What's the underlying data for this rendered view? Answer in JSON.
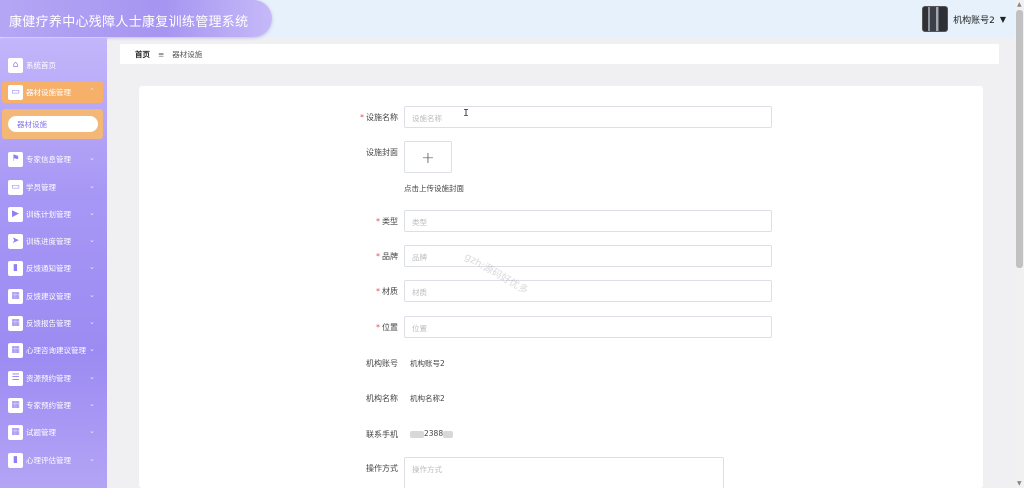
{
  "app": {
    "title": "康健疗养中心残障人士康复训练管理系统"
  },
  "user": {
    "name": "机构账号2",
    "caret": "▼"
  },
  "sidebar": {
    "items": [
      {
        "label": "系统首页",
        "icon": "home-icon",
        "glyph": "⌂"
      },
      {
        "label": "器材设施管理",
        "icon": "monitor-icon",
        "glyph": "▭",
        "chevron": "⌃"
      },
      {
        "label": "专家信息管理",
        "icon": "flag-icon",
        "glyph": "⚑",
        "chevron": "⌄"
      },
      {
        "label": "学员管理",
        "icon": "monitor-icon",
        "glyph": "▭",
        "chevron": "⌄"
      },
      {
        "label": "训练计划管理",
        "icon": "video-icon",
        "glyph": "▶",
        "chevron": "⌄"
      },
      {
        "label": "训练进度管理",
        "icon": "send-icon",
        "glyph": "➤",
        "chevron": "⌄"
      },
      {
        "label": "反馈通知管理",
        "icon": "bar-chart-icon",
        "glyph": "▮",
        "chevron": "⌄"
      },
      {
        "label": "反馈建议管理",
        "icon": "grid-icon",
        "glyph": "▦",
        "chevron": "⌄"
      },
      {
        "label": "反馈报告管理",
        "icon": "grid-icon",
        "glyph": "▦",
        "chevron": "⌄"
      },
      {
        "label": "心理咨询建议管理",
        "icon": "grid-icon",
        "glyph": "▦",
        "chevron": "⌄"
      },
      {
        "label": "资源预约管理",
        "icon": "sliders-icon",
        "glyph": "☰",
        "chevron": "⌄"
      },
      {
        "label": "专家预约管理",
        "icon": "apps-icon",
        "glyph": "▦",
        "chevron": "⌄"
      },
      {
        "label": "试题管理",
        "icon": "grid-icon",
        "glyph": "▦",
        "chevron": "⌄"
      },
      {
        "label": "心理评估管理",
        "icon": "book-icon",
        "glyph": "▮",
        "chevron": "⌄"
      }
    ],
    "sub_item": "器材设施"
  },
  "breadcrumb": {
    "home": "首页",
    "separator": "≡",
    "current": "器材设施"
  },
  "form": {
    "name": {
      "label": "设施名称",
      "placeholder": "设施名称",
      "required": "*"
    },
    "cover": {
      "label": "设施封面",
      "plus": "+",
      "tip": "点击上传设施封面"
    },
    "type": {
      "label": "类型",
      "placeholder": "类型",
      "required": "*"
    },
    "brand": {
      "label": "品牌",
      "placeholder": "品牌",
      "required": "*"
    },
    "material": {
      "label": "材质",
      "placeholder": "材质",
      "required": "*"
    },
    "location": {
      "label": "位置",
      "placeholder": "位置",
      "required": "*"
    },
    "org_account": {
      "label": "机构账号",
      "value": "机构账号2"
    },
    "org_name": {
      "label": "机构名称",
      "value": "机构名称2"
    },
    "phone": {
      "label": "联系手机",
      "value": "2388"
    },
    "operation": {
      "label": "操作方式",
      "placeholder": "操作方式"
    }
  },
  "watermark": "gzh:源码好优多",
  "colors": {
    "sidebar": "#a797f5",
    "active": "#f6b06a",
    "required": "#e65050"
  }
}
